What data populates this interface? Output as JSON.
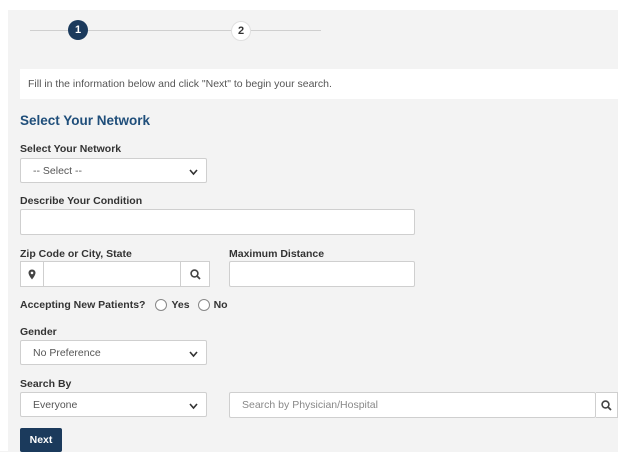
{
  "stepper": {
    "step1": "1",
    "step2": "2"
  },
  "info_text": "Fill in the information below and click \"Next\" to begin your search.",
  "section_title": "Select Your Network",
  "network": {
    "label": "Select Your Network",
    "value": "-- Select --"
  },
  "condition": {
    "label": "Describe Your Condition",
    "value": ""
  },
  "zip": {
    "label": "Zip Code or City, State",
    "value": ""
  },
  "distance": {
    "label": "Maximum Distance",
    "value": ""
  },
  "accepting": {
    "label": "Accepting New Patients?",
    "yes": "Yes",
    "no": "No"
  },
  "gender": {
    "label": "Gender",
    "value": "No Preference"
  },
  "search_by": {
    "label": "Search By",
    "value": "Everyone",
    "placeholder": "Search by Physician/Hospital"
  },
  "next_label": "Next",
  "colors": {
    "primary": "#1b3a5c",
    "heading": "#1f4e7a",
    "background": "#f3f3f3"
  }
}
